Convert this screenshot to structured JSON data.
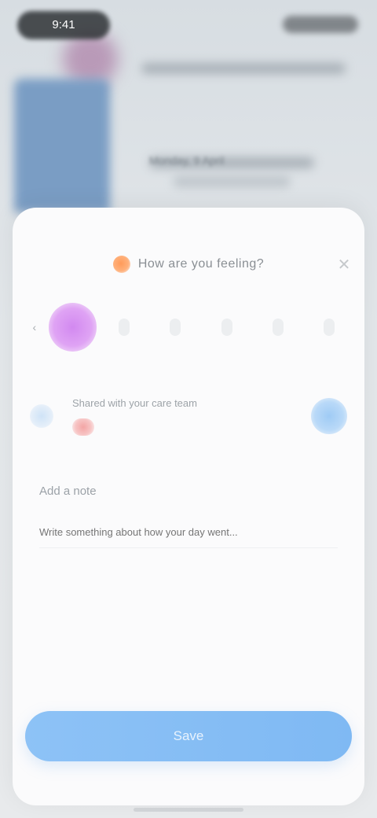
{
  "status_bar": {
    "time": "9:41",
    "signal_icon": "signal-icon",
    "battery_icon": "battery-icon"
  },
  "background": {
    "caption": "Monday, 9 April"
  },
  "sheet": {
    "title": "How are you feeling?",
    "title_icon": "mood-icon",
    "close_icon": "close-icon",
    "reactions": [
      {
        "name": "happy",
        "selected": true
      },
      {
        "name": "calm",
        "selected": false
      },
      {
        "name": "neutral",
        "selected": false
      },
      {
        "name": "sad",
        "selected": false
      },
      {
        "name": "angry",
        "selected": false
      },
      {
        "name": "tired",
        "selected": false
      }
    ],
    "card": {
      "line": "Shared with your care team",
      "left_icon": "lock-icon",
      "badge_icon": "heart-icon",
      "action_icon": "send-icon"
    },
    "notes": {
      "title": "Add a note",
      "placeholder": "Write something about how your day went..."
    },
    "primary_button": "Save"
  },
  "colors": {
    "accent": "#7fb9f3",
    "selected_reaction": "#d289f0",
    "title_icon": "#ff9b5a"
  }
}
